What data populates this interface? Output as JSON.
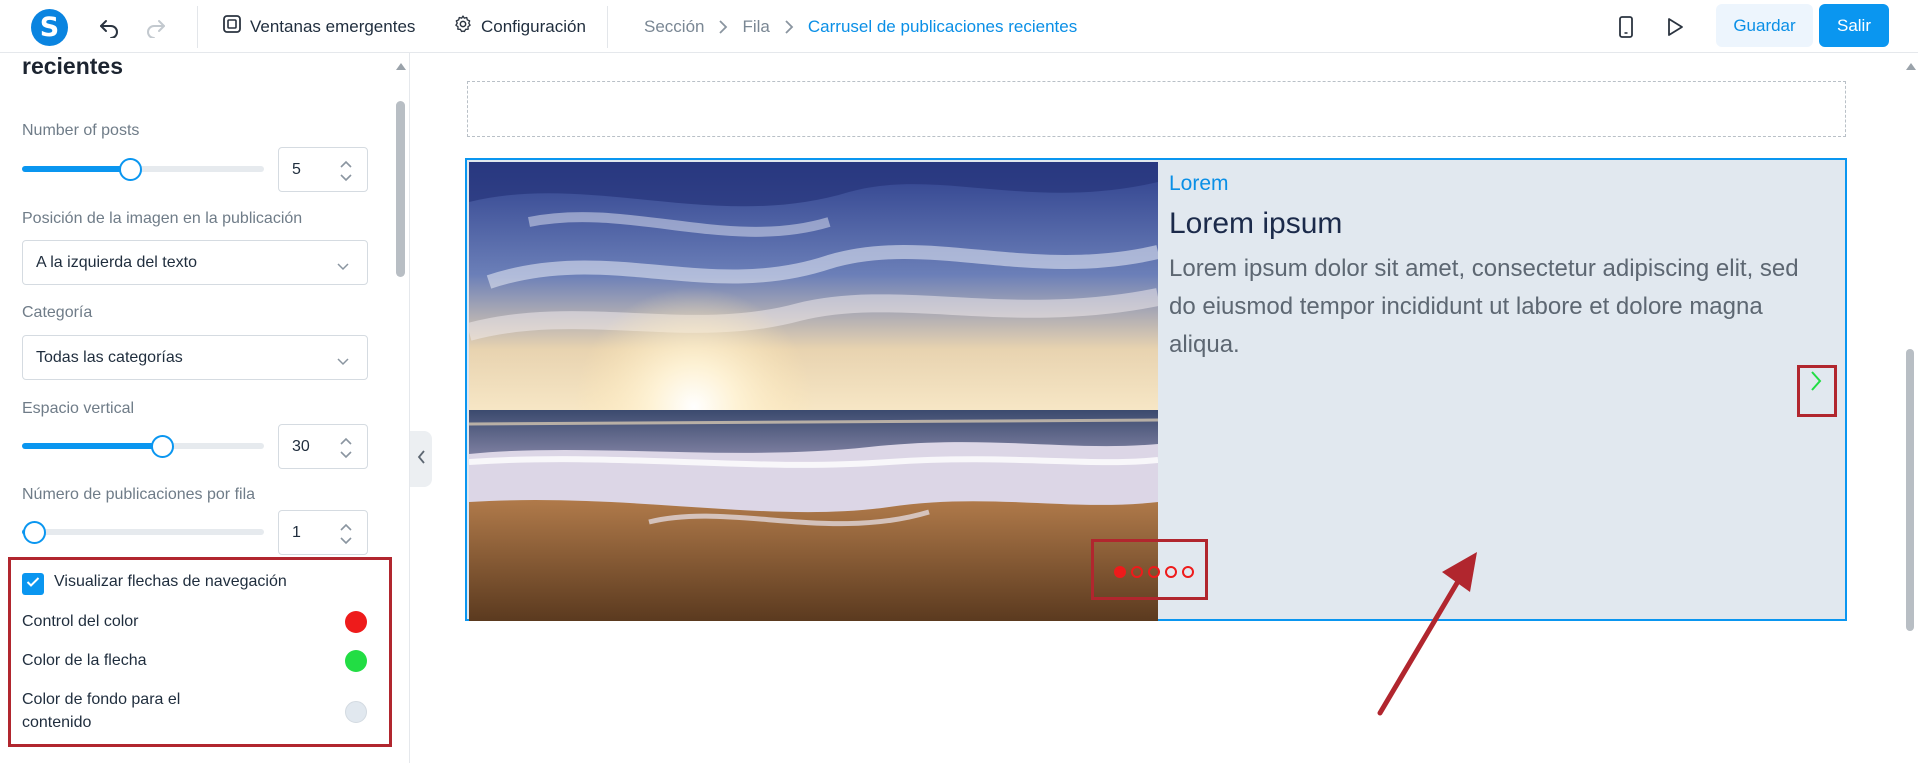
{
  "topbar": {
    "popups_label": "Ventanas emergentes",
    "settings_label": "Configuración",
    "breadcrumb": [
      "Sección",
      "Fila",
      "Carrusel de publicaciones recientes"
    ],
    "save_label": "Guardar",
    "exit_label": "Salir"
  },
  "panel": {
    "title": "recientes",
    "number_of_posts": {
      "label": "Number of posts",
      "value": "5",
      "slider_fraction": 0.45
    },
    "image_position": {
      "label": "Posición de la imagen en la publicación",
      "value": "A la izquierda del texto"
    },
    "category": {
      "label": "Categoría",
      "value": "Todas las categorías"
    },
    "vertical_space": {
      "label": "Espacio vertical",
      "value": "30",
      "slider_fraction": 0.58
    },
    "posts_per_row": {
      "label": "Número de publicaciones por fila",
      "value": "1",
      "slider_fraction": 0.05
    },
    "show_nav_arrows": {
      "label": "Visualizar flechas de navegación",
      "checked": true
    },
    "control_color": {
      "label": "Control del color",
      "color": "#ee1b1b"
    },
    "arrow_color": {
      "label": "Color de la flecha",
      "color": "#22dd44"
    },
    "content_bg_color": {
      "label": "Color de fondo para el contenido",
      "color": "#e1e8ef"
    }
  },
  "carousel": {
    "category": "Lorem",
    "title": "Lorem ipsum",
    "excerpt": "Lorem ipsum dolor sit amet, consectetur adipiscing elit, sed do eiusmod tempor incididunt ut labore et dolore magna aliqua.",
    "dots_total": 5,
    "dots_active": 0
  },
  "colors": {
    "accent": "#0a96f0",
    "annotation": "#b1262e"
  }
}
